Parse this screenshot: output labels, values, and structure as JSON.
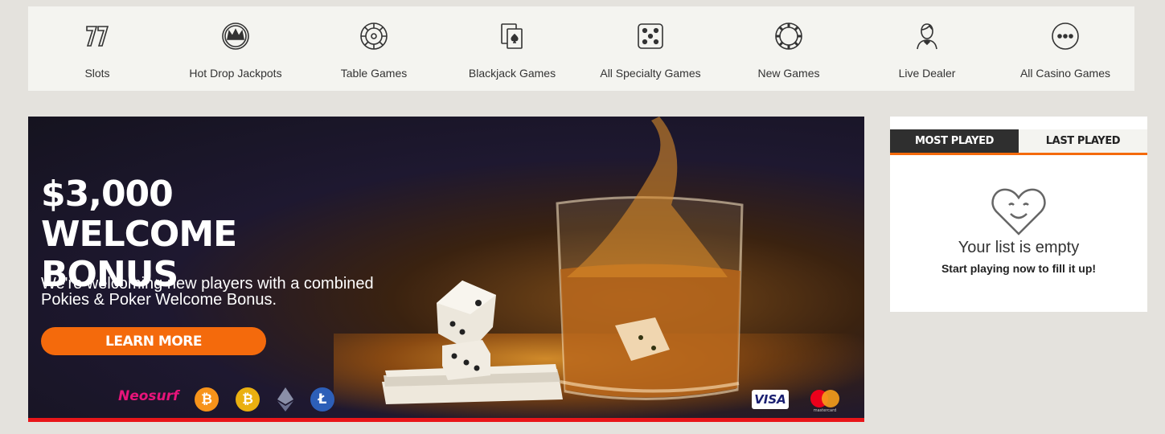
{
  "nav": {
    "items": [
      {
        "label": "Slots",
        "icon": "slots-7-icon"
      },
      {
        "label": "Hot Drop Jackpots",
        "icon": "crown-icon"
      },
      {
        "label": "Table Games",
        "icon": "roulette-icon"
      },
      {
        "label": "Blackjack Games",
        "icon": "cards-icon"
      },
      {
        "label": "All Specialty Games",
        "icon": "dice-icon"
      },
      {
        "label": "New Games",
        "icon": "chip-icon"
      },
      {
        "label": "Live Dealer",
        "icon": "dealer-icon"
      },
      {
        "label": "All Casino Games",
        "icon": "more-icon"
      }
    ]
  },
  "banner": {
    "title_line1": "$3,000 WELCOME",
    "title_line2": "BONUS",
    "text": "We're welcoming new players with a combined Pokies & Poker Welcome Bonus.",
    "cta": "LEARN MORE",
    "payments": {
      "neosurf": "Neosurf",
      "visa": "VISA",
      "mastercard_label": "mastercard"
    },
    "colors": {
      "accent": "#f46a0c",
      "bottom_bar": "#e8161a"
    }
  },
  "sidebar": {
    "tabs": [
      {
        "label": "MOST PLAYED",
        "active": true
      },
      {
        "label": "LAST PLAYED",
        "active": false
      }
    ],
    "empty_title": "Your list is empty",
    "empty_subtitle": "Start playing now to fill it up!"
  }
}
